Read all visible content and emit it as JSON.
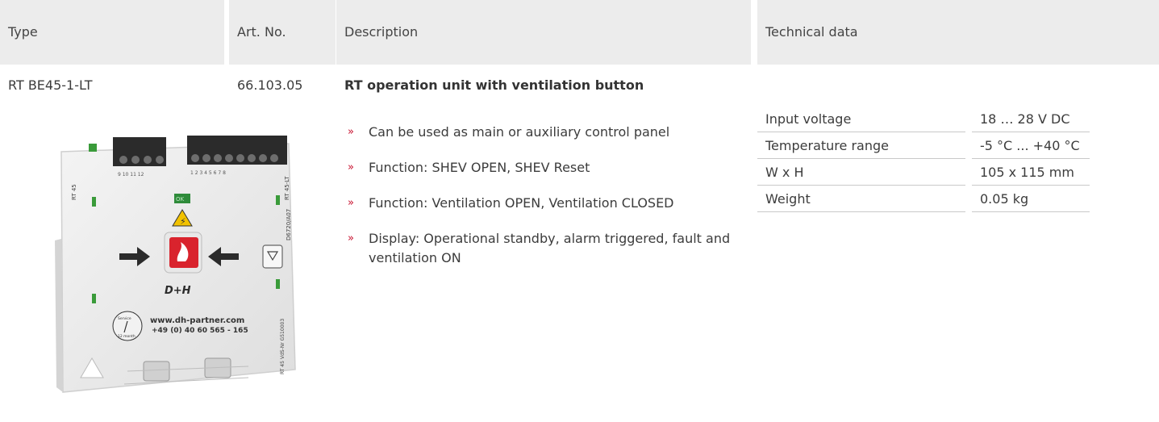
{
  "header": {
    "type": "Type",
    "art_no": "Art. No.",
    "description": "Description",
    "technical_data": "Technical data"
  },
  "row": {
    "type": "RT BE45-1-LT",
    "art_no": "66.103.05",
    "title": "RT operation unit with ventilation button",
    "bullet_mark": "»",
    "bullets": [
      "Can be used as main or auxiliary control panel",
      "Function: SHEV OPEN, SHEV Reset",
      "Function: Ventilation OPEN, Ventilation CLOSED",
      "Display: Operational standby, alarm triggered, fault and ventilation ON"
    ],
    "specs": [
      {
        "label": "Input voltage",
        "value": "18 … 28 V DC"
      },
      {
        "label": "Temperature range",
        "value": "-5 °C ... +40 °C"
      },
      {
        "label": "W x H",
        "value": "105 x 115 mm"
      },
      {
        "label": "Weight",
        "value": "0.05 kg"
      }
    ]
  },
  "device": {
    "label_top": "RT 45",
    "label_side": "RT 45-LT",
    "code": "D6720/A07",
    "terminals_left": "9  10  11  12",
    "terminals_right": "1  2  3  4  5  6  7  8",
    "ok_label": "OK",
    "brand": "D+H",
    "service_label": "Service",
    "service_period": "12 month",
    "website": "www.dh-partner.com",
    "phone": "+49 (0) 40 60 565 - 165",
    "vds_label": "RT 45 VdS-Nr G510003"
  },
  "colors": {
    "accent": "#c8102e",
    "header_bg": "#ececec",
    "rule": "#c9c9c9"
  }
}
